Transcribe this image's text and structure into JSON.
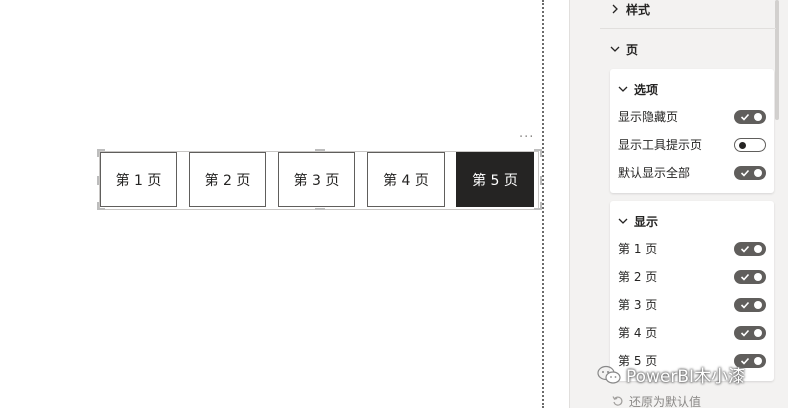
{
  "canvas": {
    "more_options": "···",
    "page_navigator": {
      "buttons": [
        {
          "label": "第 1 页",
          "active": false
        },
        {
          "label": "第 2 页",
          "active": false
        },
        {
          "label": "第 3 页",
          "active": false
        },
        {
          "label": "第 4 页",
          "active": false
        },
        {
          "label": "第 5 页",
          "active": true
        }
      ],
      "active_fill": "#252423",
      "active_text": "#ffffff"
    }
  },
  "format_pane": {
    "sections": {
      "style": {
        "label": "样式",
        "expanded": false
      },
      "pages": {
        "label": "页",
        "expanded": true
      }
    },
    "options_card": {
      "title": "选项",
      "rows": [
        {
          "label": "显示隐藏页",
          "toggle": "on"
        },
        {
          "label": "显示工具提示页",
          "toggle": "off"
        },
        {
          "label": "默认显示全部",
          "toggle": "on"
        }
      ]
    },
    "show_card": {
      "title": "显示",
      "rows": [
        {
          "label": "第 1 页",
          "toggle": "on"
        },
        {
          "label": "第 2 页",
          "toggle": "on"
        },
        {
          "label": "第 3 页",
          "toggle": "on"
        },
        {
          "label": "第 4 页",
          "toggle": "on"
        },
        {
          "label": "第 5 页",
          "toggle": "on"
        }
      ]
    },
    "reset_label": "还原为默认值"
  },
  "watermark": "PowerBI木小漆",
  "icons": {
    "chevron_right": "chevron-right-icon",
    "chevron_down": "chevron-down-icon",
    "reset": "reset-icon",
    "wechat": "wechat-icon"
  }
}
